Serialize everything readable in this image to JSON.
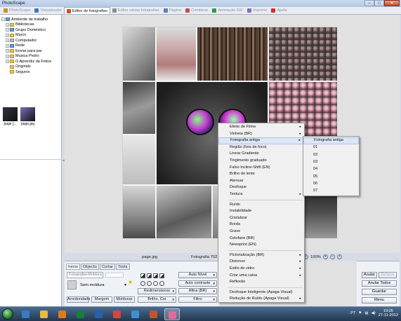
{
  "window": {
    "title": "PhotoScape",
    "min": "–",
    "max": "□",
    "close": "✕"
  },
  "tabs": [
    {
      "label": "PhotoScape",
      "icon": "photoscape-icon",
      "active": false
    },
    {
      "label": "Visualizador",
      "icon": "viewer-icon",
      "active": false
    },
    {
      "label": "Editor de fotografias",
      "icon": "editor-icon",
      "active": true
    },
    {
      "label": "Editor várias fotografias",
      "icon": "batch-editor-icon",
      "active": false
    },
    {
      "label": "Página",
      "icon": "page-icon",
      "active": false
    },
    {
      "label": "Combinar",
      "icon": "combine-icon",
      "active": false
    },
    {
      "label": "Animação GIF",
      "icon": "gif-icon",
      "active": false
    },
    {
      "label": "Imprimir",
      "icon": "print-icon",
      "active": false
    },
    {
      "label": "Ajuda",
      "icon": "help-icon",
      "active": false
    }
  ],
  "tree": [
    {
      "label": "Ambiente de trabalho",
      "expander": "−",
      "indent": 0,
      "color": "blue"
    },
    {
      "label": "Bibliotecas",
      "expander": "+",
      "indent": 1,
      "color": "yellow"
    },
    {
      "label": "Grupo Doméstico",
      "expander": "+",
      "indent": 1,
      "color": "blue"
    },
    {
      "label": "Marco",
      "expander": "+",
      "indent": 1,
      "color": "yellow"
    },
    {
      "label": "Computador",
      "expander": "+",
      "indent": 1,
      "color": "gray"
    },
    {
      "label": "Rede",
      "expander": "+",
      "indent": 1,
      "color": "blue"
    },
    {
      "label": "Enviar para par",
      "expander": "+",
      "indent": 1,
      "color": "yellow"
    },
    {
      "label": "Musica Pedro",
      "expander": "+",
      "indent": 1,
      "color": "yellow"
    },
    {
      "label": "O Aprendiz da Fetice",
      "expander": "+",
      "indent": 1,
      "color": "yellow"
    },
    {
      "label": "Originals",
      "expander": "",
      "indent": 1,
      "color": "yellow"
    },
    {
      "label": "Seguros",
      "expander": "",
      "indent": 1,
      "color": "yellow"
    }
  ],
  "thumbnails": [
    {
      "caption": "page [...",
      "color": "#2f3342"
    },
    {
      "caption": "page.jpg",
      "color": "#7b6fb8"
    }
  ],
  "status": {
    "filename": "page.jpg",
    "info": "Fotografia 702 x 7",
    "zoom": "100%"
  },
  "edit_panel": {
    "tabs": [
      "Início",
      "Objecto",
      "Cortar",
      "Tools"
    ],
    "active_tab": "Início",
    "frame_select": "Fotografia+Moldura",
    "frame_label": "Sem moldura",
    "buttons": {
      "round": "Arredondado",
      "margin": "Margem",
      "frames": "Molduras",
      "auto_level": "Auto Nível",
      "auto_contrast": "Auto contraste",
      "resize": "Redimensionar",
      "sharpen": "Afina (BR)",
      "brightness": "Brilho, Cor",
      "filter": "Filtro"
    }
  },
  "right_buttons": {
    "undo": "Anular",
    "redo": "Refazer",
    "undo_all": "Anular Todos",
    "save": "Guardar",
    "menu": "Menu"
  },
  "context_menu": {
    "items": [
      {
        "label": "Efeito de Filme",
        "sub": true
      },
      {
        "label": "Vinheta (BR)",
        "sub": true
      },
      {
        "label": "Fotografia antiga",
        "sub": true,
        "highlight": true
      },
      {
        "label": "Região (fora de foco)",
        "sub": false
      },
      {
        "label": "Linear Gradiente",
        "sub": false
      },
      {
        "label": "Tingimento graduado",
        "sub": false
      },
      {
        "label": "Falso Incline-Shift (EN)",
        "sub": false
      },
      {
        "label": "Brilho de lente",
        "sub": false
      },
      {
        "label": "Atenuar",
        "sub": false
      },
      {
        "label": "Desfoque",
        "sub": false
      },
      {
        "label": "Textura",
        "sub": true
      },
      {
        "sep": true
      },
      {
        "label": "Ruído",
        "sub": false
      },
      {
        "label": "Instabilidade",
        "sub": false
      },
      {
        "label": "Cristalizar",
        "sub": false
      },
      {
        "label": "Borda",
        "sub": false
      },
      {
        "label": "Grave",
        "sub": false
      },
      {
        "label": "Celofane (BR)",
        "sub": false
      },
      {
        "label": "Newsprint (EN)",
        "sub": false
      },
      {
        "sep": true
      },
      {
        "label": "Pictorialização (BR)",
        "sub": true
      },
      {
        "label": "Distorcer",
        "sub": true
      },
      {
        "label": "Estilo de vidro",
        "sub": true
      },
      {
        "label": "Criar uma caixa",
        "sub": true
      },
      {
        "label": "Reflexão",
        "sub": false
      },
      {
        "sep": true
      },
      {
        "label": "Desfoque Inteligente (Apaga Visual)",
        "sub": false
      },
      {
        "label": "Redução de Ruído (Apaga Visual)",
        "sub": true
      }
    ]
  },
  "submenu": {
    "items": [
      {
        "label": "Fotografia antiga",
        "highlight": true
      },
      {
        "label": "01"
      },
      {
        "label": "02"
      },
      {
        "label": "03"
      },
      {
        "label": "04"
      },
      {
        "label": "05"
      },
      {
        "label": "06"
      },
      {
        "label": "07"
      }
    ]
  },
  "taskbar": {
    "time": "19:05",
    "date": "27-11-2012",
    "language": "PT",
    "apps": [
      {
        "name": "ie-icon",
        "color": "#3b78c8"
      },
      {
        "name": "explorer-icon",
        "color": "#e8b84a"
      },
      {
        "name": "media-player-icon",
        "color": "#e07a1f"
      },
      {
        "name": "excel-icon",
        "color": "#1d7a3c"
      },
      {
        "name": "word-icon",
        "color": "#2b5faa"
      },
      {
        "name": "chrome-icon",
        "color": "#d9453a"
      },
      {
        "name": "windows-media-center-icon",
        "color": "#3d8fd6"
      },
      {
        "name": "powerpoint-icon",
        "color": "#c4542a"
      },
      {
        "name": "photoscape-taskbar-icon",
        "color": "#e26a9a",
        "active": true
      }
    ]
  }
}
